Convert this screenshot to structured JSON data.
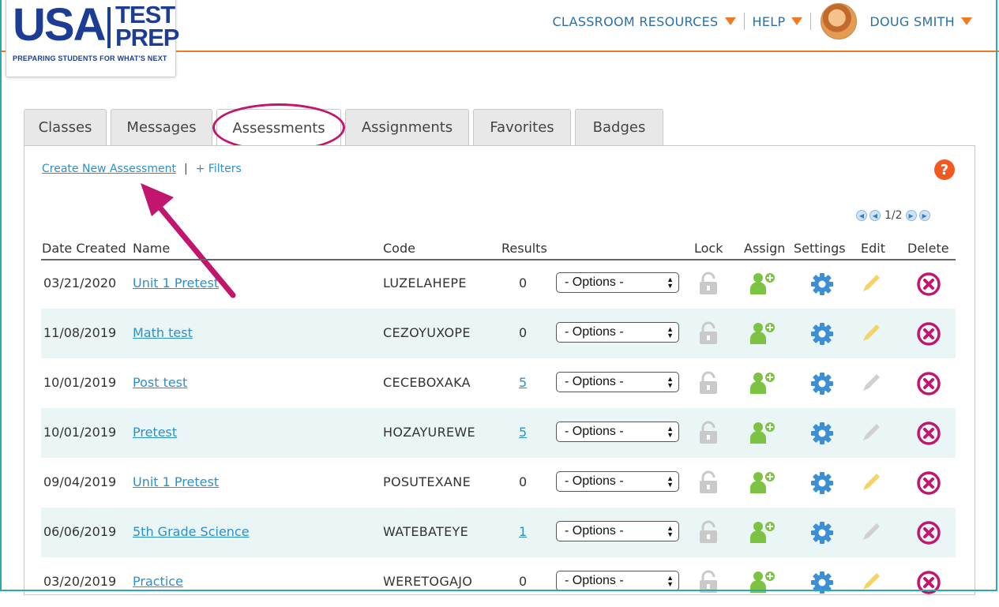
{
  "logo": {
    "line1": "USA",
    "line2a": "TEST",
    "line2b": "PREP",
    "tagline": "PREPARING STUDENTS FOR WHAT'S NEXT"
  },
  "topnav": {
    "resources": "CLASSROOM RESOURCES",
    "help": "HELP",
    "user": "DOUG SMITH"
  },
  "tabs": [
    {
      "label": "Classes"
    },
    {
      "label": "Messages"
    },
    {
      "label": "Assessments"
    },
    {
      "label": "Assignments"
    },
    {
      "label": "Favorites"
    },
    {
      "label": "Badges"
    }
  ],
  "toolbar": {
    "create": "Create New Assessment",
    "separator": "|",
    "filters": "+ Filters",
    "help_icon": "?"
  },
  "pager": {
    "page": "1/2"
  },
  "columns": {
    "date": "Date Created",
    "name": "Name",
    "code": "Code",
    "results": "Results",
    "lock": "Lock",
    "assign": "Assign",
    "settings": "Settings",
    "edit": "Edit",
    "delete": "Delete"
  },
  "options_label": "- Options -",
  "rows": [
    {
      "date": "03/21/2020",
      "name": "Unit 1 Pretest",
      "code": "LUZELAHEPE",
      "results": "0",
      "results_link": false,
      "edit_active": true
    },
    {
      "date": "11/08/2019",
      "name": "Math test",
      "code": "CEZOYUXOPE",
      "results": "0",
      "results_link": false,
      "edit_active": true
    },
    {
      "date": "10/01/2019",
      "name": "Post test",
      "code": "CECEBOXAKA",
      "results": "5",
      "results_link": true,
      "edit_active": false
    },
    {
      "date": "10/01/2019",
      "name": "Pretest",
      "code": "HOZAYUREWE",
      "results": "5",
      "results_link": true,
      "edit_active": false
    },
    {
      "date": "09/04/2019",
      "name": "Unit 1 Pretest",
      "code": "POSUTEXANE",
      "results": "0",
      "results_link": false,
      "edit_active": true
    },
    {
      "date": "06/06/2019",
      "name": "5th Grade Science",
      "code": "WATEBATEYE",
      "results": "1",
      "results_link": true,
      "edit_active": false
    },
    {
      "date": "03/20/2019",
      "name": "Practice",
      "code": "WERETOGAJO",
      "results": "0",
      "results_link": false,
      "edit_active": true
    }
  ],
  "colors": {
    "brand": "#1d3c94",
    "accent": "#f07a24",
    "link": "#2d8fc9",
    "highlight": "#c2166e",
    "row_alt": "#eaf6f6"
  }
}
